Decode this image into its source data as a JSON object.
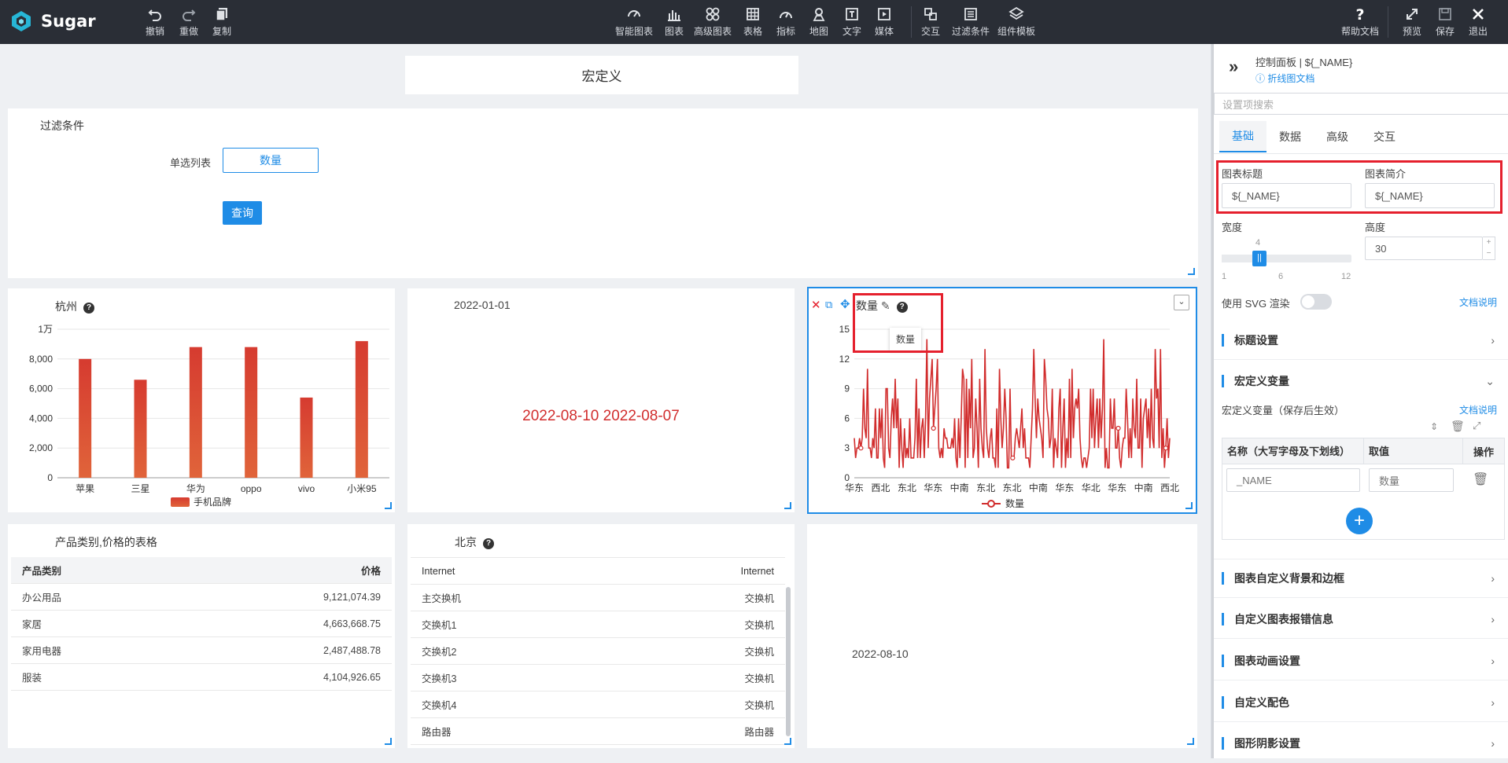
{
  "app": {
    "name": "Sugar"
  },
  "toolbar": {
    "left": [
      {
        "label": "撤销",
        "icon": "undo-icon"
      },
      {
        "label": "重做",
        "icon": "redo-icon"
      },
      {
        "label": "复制",
        "icon": "copy-icon"
      }
    ],
    "center": [
      {
        "label": "智能图表",
        "icon": "smart-chart-icon"
      },
      {
        "label": "图表",
        "icon": "bar-chart-icon"
      },
      {
        "label": "高级图表",
        "icon": "advanced-chart-icon"
      },
      {
        "label": "表格",
        "icon": "table-icon"
      },
      {
        "label": "指标",
        "icon": "gauge-icon"
      },
      {
        "label": "地图",
        "icon": "map-pin-icon"
      },
      {
        "label": "文字",
        "icon": "text-icon"
      },
      {
        "label": "媒体",
        "icon": "media-icon"
      },
      {
        "label": "交互",
        "icon": "interaction-icon"
      },
      {
        "label": "过滤条件",
        "icon": "filter-icon"
      },
      {
        "label": "组件模板",
        "icon": "template-icon"
      }
    ],
    "right": [
      {
        "label": "帮助文档",
        "icon": "help-icon"
      },
      {
        "label": "预览",
        "icon": "expand-icon"
      },
      {
        "label": "保存",
        "icon": "save-icon"
      },
      {
        "label": "退出",
        "icon": "close-icon"
      }
    ]
  },
  "page": {
    "title": "宏定义"
  },
  "filter": {
    "title": "过滤条件",
    "label": "单选列表",
    "value": "数量",
    "query_label": "查询"
  },
  "bar_chart": {
    "title": "杭州",
    "legend": "手机品牌",
    "accent": "#d63b30"
  },
  "chart_data": [
    {
      "type": "bar",
      "categories": [
        "苹果",
        "三星",
        "华为",
        "oppo",
        "vivo",
        "小米95"
      ],
      "values": [
        8000,
        6600,
        8800,
        8800,
        5400,
        9200
      ],
      "ylim": [
        0,
        10000
      ],
      "yticks": [
        "0",
        "2,000",
        "4,000",
        "6,000",
        "8,000",
        "1万"
      ],
      "series": [
        {
          "name": "手机品牌",
          "values": [
            8000,
            6600,
            8800,
            8800,
            5400,
            9200
          ]
        }
      ],
      "grid": true,
      "legend_position": "bottom"
    },
    {
      "type": "line",
      "categories": [
        "华东",
        "西北",
        "东北",
        "华东",
        "中南",
        "东北",
        "东北",
        "中南",
        "华东",
        "华北",
        "华东",
        "中南",
        "西北"
      ],
      "ylim": [
        0,
        15
      ],
      "yticks": [
        "0",
        "3",
        "6",
        "9",
        "12",
        "15"
      ],
      "series": [
        {
          "name": "数量"
        }
      ],
      "grid": true,
      "legend_position": "bottom"
    }
  ],
  "text_block": {
    "date1": "2022-01-01",
    "dates": "2022-08-10 2022-08-07",
    "date3": "2022-08-10"
  },
  "line_chart": {
    "title": "数量",
    "tooltip": "数量",
    "legend": "数量",
    "accent": "#d12d2d"
  },
  "table1": {
    "title": "产品类别,价格的表格",
    "headers": [
      "产品类别",
      "价格"
    ],
    "rows": [
      [
        "办公用品",
        "9,121,074.39"
      ],
      [
        "家居",
        "4,663,668.75"
      ],
      [
        "家用电器",
        "2,487,488.78"
      ],
      [
        "服装",
        "4,104,926.65"
      ]
    ]
  },
  "table2": {
    "title": "北京",
    "headers": [
      "Internet",
      "Internet"
    ],
    "rows": [
      [
        "主交换机",
        "交换机"
      ],
      [
        "交换机1",
        "交换机"
      ],
      [
        "交换机2",
        "交换机"
      ],
      [
        "交换机3",
        "交换机"
      ],
      [
        "交换机4",
        "交换机"
      ],
      [
        "路由器",
        "路由器"
      ]
    ]
  },
  "sidebar": {
    "title": "控制面板 | ${_NAME}",
    "doc_link": "折线图文档",
    "search_placeholder": "设置项搜索",
    "tabs": [
      "基础",
      "数据",
      "高级",
      "交互"
    ],
    "chart_title_label": "图表标题",
    "chart_title_value": "${_NAME}",
    "chart_desc_label": "图表简介",
    "chart_desc_value": "${_NAME}",
    "width_label": "宽度",
    "width_value": "4",
    "slider_min": "1",
    "slider_mid": "6",
    "slider_max": "12",
    "height_label": "高度",
    "height_value": "30",
    "svg_label": "使用 SVG 渲染",
    "doc_note": "文档说明",
    "sections": [
      "标题设置",
      "宏定义变量",
      "图表自定义背景和边框",
      "自定义图表报错信息",
      "图表动画设置",
      "自定义配色",
      "图形阴影设置"
    ],
    "macro_hint": "宏定义变量（保存后生效）",
    "macro_headers": [
      "名称（大写字母及下划线）",
      "取值",
      "操作"
    ],
    "macro_name": "_NAME",
    "macro_value": "数量"
  }
}
